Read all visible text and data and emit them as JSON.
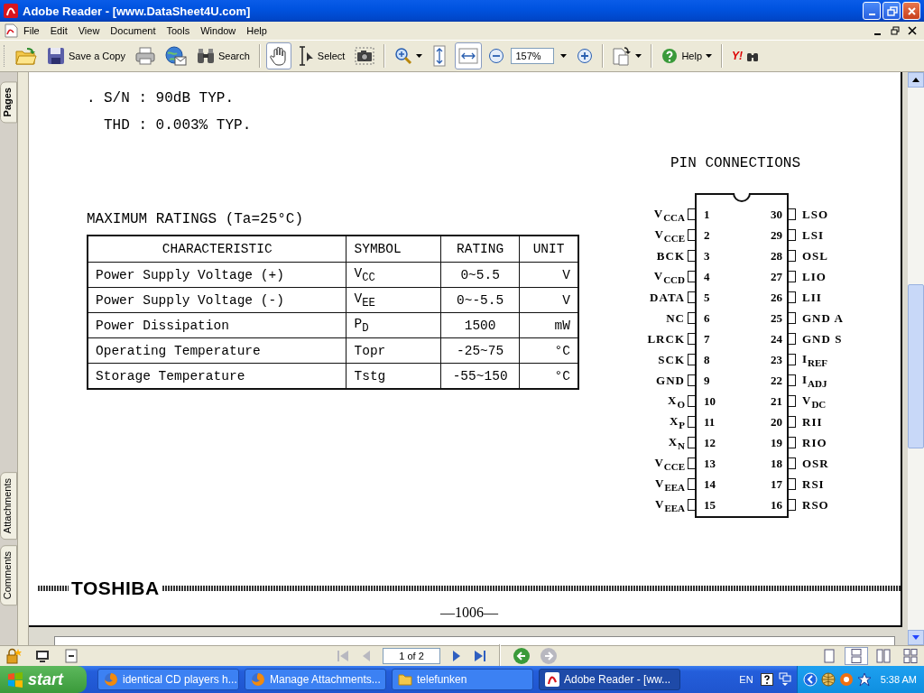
{
  "window": {
    "title": "Adobe Reader - [www.DataSheet4U.com]"
  },
  "menu": [
    "File",
    "Edit",
    "View",
    "Document",
    "Tools",
    "Window",
    "Help"
  ],
  "toolbar": [
    {
      "kind": "open",
      "pressed": false,
      "dropdown": false
    },
    {
      "kind": "save",
      "label": "Save a Copy",
      "pressed": false,
      "dropdown": false
    },
    {
      "kind": "print",
      "pressed": false,
      "dropdown": false
    },
    {
      "kind": "email",
      "pressed": false,
      "dropdown": false
    },
    {
      "kind": "search",
      "label": "Search",
      "pressed": false,
      "dropdown": false
    },
    {
      "kind": "separator"
    },
    {
      "kind": "hand",
      "pressed": true,
      "dropdown": false
    },
    {
      "kind": "select",
      "label": "Select",
      "pressed": false,
      "dropdown": false
    },
    {
      "kind": "snapshot",
      "pressed": false,
      "dropdown": false
    },
    {
      "kind": "separator"
    },
    {
      "kind": "zoom-in",
      "pressed": false,
      "dropdown": true
    },
    {
      "kind": "fit-height",
      "pressed": false,
      "dropdown": false
    },
    {
      "kind": "fit-width",
      "pressed": true,
      "dropdown": false
    },
    {
      "kind": "zoom-out",
      "pressed": false,
      "dropdown": false
    },
    {
      "kind": "zoom-field",
      "value": "157%"
    },
    {
      "kind": "zoom-plus",
      "pressed": false,
      "dropdown": false
    },
    {
      "kind": "separator"
    },
    {
      "kind": "rotate",
      "pressed": false,
      "dropdown": true
    },
    {
      "kind": "separator"
    },
    {
      "kind": "help",
      "label": "Help",
      "pressed": false,
      "dropdown": true
    },
    {
      "kind": "separator"
    },
    {
      "kind": "yahoo",
      "label": "Y!",
      "pressed": false,
      "dropdown": false
    }
  ],
  "side_tabs": [
    "Pages",
    "Attachments",
    "Comments"
  ],
  "document": {
    "spec_lines": [
      {
        "bullet": ".",
        "text": "S/N : 90dB TYP."
      },
      {
        "text": "THD : 0.003% TYP."
      }
    ],
    "ratings": {
      "title": "MAXIMUM RATINGS (Ta=25°C)",
      "columns": [
        "CHARACTERISTIC",
        "SYMBOL",
        "RATING",
        "UNIT"
      ],
      "rows": [
        [
          "Power Supply Voltage (+)",
          "V$_{CC}$",
          "0~5.5",
          "V"
        ],
        [
          "Power Supply Voltage (-)",
          "V$_{EE}$",
          "0~-5.5",
          "V"
        ],
        [
          "Power Dissipation",
          "P$_{D}$",
          "1500",
          "mW"
        ],
        [
          "Operating Temperature",
          "Topr",
          "-25~75",
          "°C"
        ],
        [
          "Storage Temperature",
          "Tstg",
          "-55~150",
          "°C"
        ]
      ]
    },
    "pin_connections": {
      "title": "PIN CONNECTIONS",
      "left_pins": [
        {
          "number": "1",
          "label": "V$_{CCA}$"
        },
        {
          "number": "2",
          "label": "V$_{CCE}$"
        },
        {
          "number": "3",
          "label": "BCK"
        },
        {
          "number": "4",
          "label": "V$_{CCD}$"
        },
        {
          "number": "5",
          "label": "DATA"
        },
        {
          "number": "6",
          "label": "NC"
        },
        {
          "number": "7",
          "label": "LRCK"
        },
        {
          "number": "8",
          "label": "SCK"
        },
        {
          "number": "9",
          "label": "GND"
        },
        {
          "number": "10",
          "label": "X$_{O}$"
        },
        {
          "number": "11",
          "label": "X$_{P}$"
        },
        {
          "number": "12",
          "label": "X$_{N}$"
        },
        {
          "number": "13",
          "label": "V$_{CCE}$"
        },
        {
          "number": "14",
          "label": "V$_{EEA}$"
        },
        {
          "number": "15",
          "label": "V$_{EEA}$"
        }
      ],
      "right_pins": [
        {
          "number": "30",
          "label": "LSO"
        },
        {
          "number": "29",
          "label": "LSI"
        },
        {
          "number": "28",
          "label": "OSL"
        },
        {
          "number": "27",
          "label": "LIO"
        },
        {
          "number": "26",
          "label": "LII"
        },
        {
          "number": "25",
          "label": "GND A"
        },
        {
          "number": "24",
          "label": "GND S"
        },
        {
          "number": "23",
          "label": "I$_{REF}$"
        },
        {
          "number": "22",
          "label": "I$_{ADJ}$"
        },
        {
          "number": "21",
          "label": "V$_{DC}$"
        },
        {
          "number": "20",
          "label": "RII"
        },
        {
          "number": "19",
          "label": "RIO"
        },
        {
          "number": "18",
          "label": "OSR"
        },
        {
          "number": "17",
          "label": "RSI"
        },
        {
          "number": "16",
          "label": "RSO"
        }
      ]
    },
    "footer": {
      "logo": "TOSHIBA",
      "page_number": "—1006—"
    }
  },
  "statusbar": {
    "tools": [
      {
        "kind": "screen"
      },
      {
        "kind": "page"
      }
    ],
    "navigation": [
      {
        "kind": "first",
        "disabled": true
      },
      {
        "kind": "prev",
        "disabled": true
      },
      {
        "kind": "page-field",
        "value": "1 of 2"
      },
      {
        "kind": "next",
        "disabled": false
      },
      {
        "kind": "last",
        "disabled": false
      },
      {
        "kind": "separator"
      },
      {
        "kind": "back",
        "disabled": false
      },
      {
        "kind": "forward",
        "disabled": true
      }
    ],
    "views": [
      {
        "kind": "single",
        "selected": false
      },
      {
        "kind": "continuous",
        "selected": true
      },
      {
        "kind": "facing",
        "selected": false
      },
      {
        "kind": "continuous-facing",
        "selected": false
      }
    ]
  },
  "taskbar": {
    "start": "start",
    "tasks": [
      {
        "kind": "browser",
        "label": "identical CD players h...",
        "selected": false
      },
      {
        "kind": "browser",
        "label": "Manage Attachments...",
        "selected": false
      },
      {
        "kind": "folder",
        "label": "telefunken",
        "selected": false
      },
      {
        "kind": "reader",
        "label": "Adobe Reader - [ww...",
        "selected": true
      }
    ],
    "language": "EN",
    "clock": "5:38 AM"
  }
}
